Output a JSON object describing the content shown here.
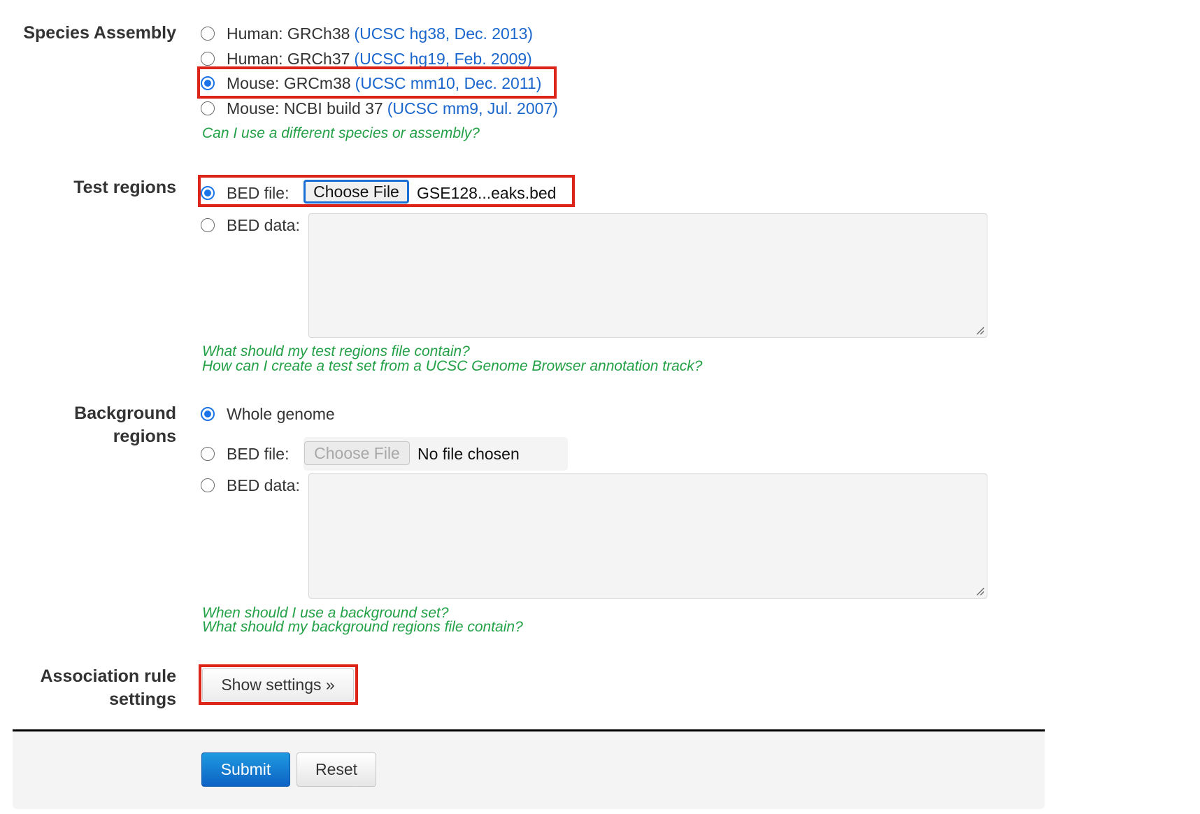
{
  "species": {
    "label": "Species Assembly",
    "options": [
      {
        "name": "Human: GRCh38",
        "link": "(UCSC hg38, Dec. 2013)",
        "checked": false
      },
      {
        "name": "Human: GRCh37",
        "link": "(UCSC hg19, Feb. 2009)",
        "checked": false
      },
      {
        "name": "Mouse: GRCm38",
        "link": "(UCSC mm10, Dec. 2011)",
        "checked": true
      },
      {
        "name": "Mouse: NCBI build 37",
        "link": "(UCSC mm9, Jul. 2007)",
        "checked": false
      }
    ],
    "help": "Can I use a different species or assembly?"
  },
  "test_regions": {
    "label": "Test regions",
    "bed_file_label": "BED file:",
    "choose_file_label": "Choose File",
    "file_name": "GSE128...eaks.bed",
    "bed_data_label": "BED data:",
    "bed_data_value": "",
    "selected": "bed_file",
    "help": [
      "What should my test regions file contain?",
      "How can I create a test set from a UCSC Genome Browser annotation track?"
    ]
  },
  "background_regions": {
    "label_line1": "Background",
    "label_line2": "regions",
    "whole_genome_label": "Whole genome",
    "bed_file_label": "BED file:",
    "choose_file_label": "Choose File",
    "file_name": "No file chosen",
    "bed_data_label": "BED data:",
    "bed_data_value": "",
    "selected": "whole_genome",
    "help": [
      "When should I use a background set?",
      "What should my background regions file contain?"
    ]
  },
  "association": {
    "label_line1": "Association rule",
    "label_line2": "settings",
    "show_settings_label": "Show settings »"
  },
  "footer": {
    "submit_label": "Submit",
    "reset_label": "Reset"
  },
  "colors": {
    "highlight": "#dd2419",
    "link": "#1a66cc",
    "help": "#22a046",
    "primary": "#1a73d0"
  }
}
